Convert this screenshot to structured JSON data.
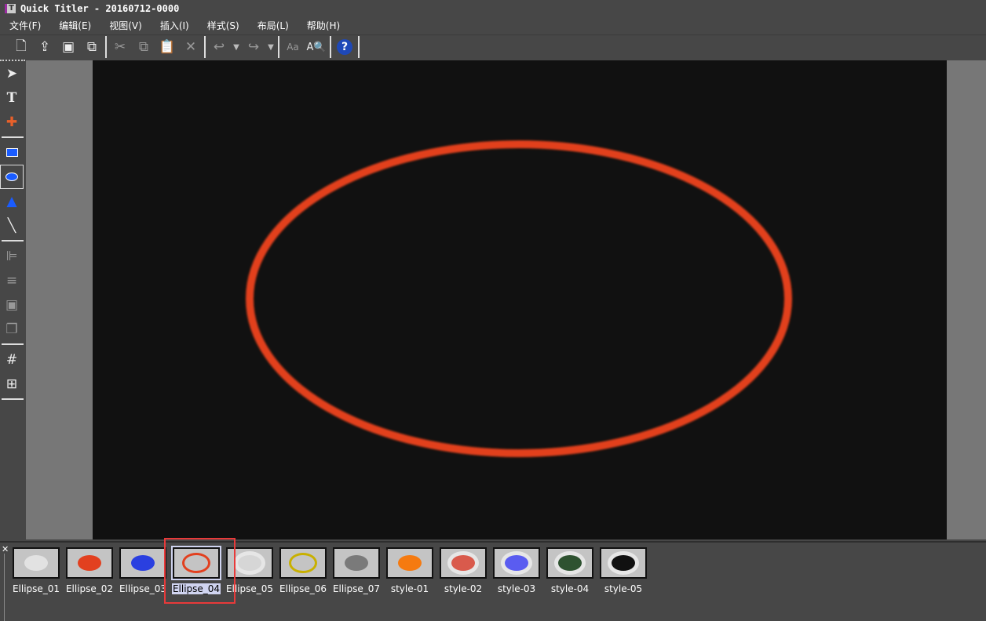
{
  "window": {
    "title": "Quick Titler - 20160712-0000"
  },
  "menu": [
    "文件(F)",
    "编辑(E)",
    "视图(V)",
    "插入(I)",
    "样式(S)",
    "布局(L)",
    "帮助(H)"
  ],
  "toolbar": {
    "new": "new-file-icon",
    "open": "import-icon",
    "save": "save-icon",
    "save_all": "save-all-icon",
    "cut": "cut-icon",
    "copy": "copy-icon",
    "paste": "paste-icon",
    "delete": "delete-icon",
    "undo": "undo-icon",
    "redo": "redo-icon",
    "font": "font-style-icon",
    "find": "find-text-icon",
    "help": "?"
  },
  "tools": [
    "select",
    "text",
    "crop",
    "rectangle",
    "ellipse",
    "triangle",
    "line",
    "align",
    "distribute",
    "center",
    "order",
    "grid",
    "table"
  ],
  "selected_tool": "ellipse",
  "canvas": {
    "ellipse_color": "#e2401f",
    "background": "#111111"
  },
  "palette": {
    "selected": "Ellipse_04",
    "items": [
      {
        "label": "Ellipse_01",
        "fill": "#e2e2e2",
        "ring": ""
      },
      {
        "label": "Ellipse_02",
        "fill": "#e2401f",
        "ring": ""
      },
      {
        "label": "Ellipse_03",
        "fill": "#2a3fe0",
        "ring": ""
      },
      {
        "label": "Ellipse_04",
        "fill": "transparent",
        "ring": "#e2401f"
      },
      {
        "label": "Ellipse_05",
        "fill": "#d6d6d6",
        "ring": "#e6e6e6"
      },
      {
        "label": "Ellipse_06",
        "fill": "transparent",
        "ring": "#c8b000"
      },
      {
        "label": "Ellipse_07",
        "fill": "#7a7a7a",
        "ring": ""
      },
      {
        "label": "style-01",
        "fill": "#f57a10",
        "ring": ""
      },
      {
        "label": "style-02",
        "fill": "#d95a4c",
        "ring": "#e6e6e6"
      },
      {
        "label": "style-03",
        "fill": "#5a5cf0",
        "ring": "#e6e6e6"
      },
      {
        "label": "style-04",
        "fill": "#2e5230",
        "ring": "#e6e6e6"
      },
      {
        "label": "style-05",
        "fill": "#111111",
        "ring": "#e6e6e6"
      }
    ]
  }
}
